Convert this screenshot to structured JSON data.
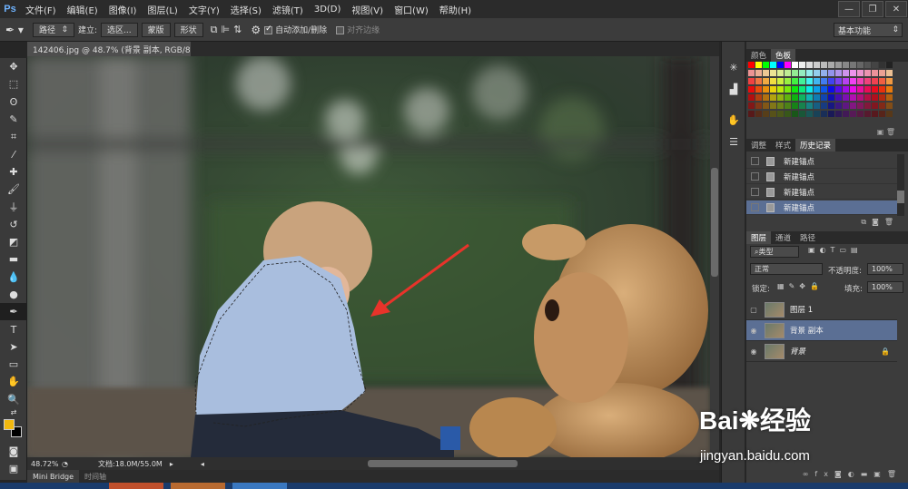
{
  "app": {
    "logo": "Ps"
  },
  "menu": [
    "文件(F)",
    "编辑(E)",
    "图像(I)",
    "图层(L)",
    "文字(Y)",
    "选择(S)",
    "滤镜(T)",
    "3D(D)",
    "视图(V)",
    "窗口(W)",
    "帮助(H)"
  ],
  "window_controls": [
    "—",
    "❐",
    "✕"
  ],
  "options": {
    "mode": "路径",
    "make_label": "建立:",
    "selection_btn": "选区...",
    "mask_btn": "蒙版",
    "shape_btn": "形状",
    "auto_add_delete": "自动添加/删除",
    "align_edges": "对齐边缘",
    "workspace": "基本功能"
  },
  "document": {
    "tab": "142406.jpg @ 48.7% (背景 副本, RGB/8#) *",
    "zoom": "48.72%",
    "doc_size": "文档:18.0M/55.0M"
  },
  "bottom_tabs": [
    "Mini Bridge",
    "时间轴"
  ],
  "panels": {
    "swatch_tabs": [
      "颜色",
      "色板"
    ],
    "history_tabs": [
      "调整",
      "样式",
      "历史记录"
    ],
    "history_items": [
      "新建锚点",
      "新建锚点",
      "新建锚点",
      "新建锚点"
    ],
    "layers_tabs": [
      "图层",
      "通道",
      "路径"
    ],
    "filter_kind": "类型",
    "blend_mode": "正常",
    "opacity_label": "不透明度:",
    "opacity_value": "100%",
    "lock_label": "锁定:",
    "fill_label": "填充:",
    "fill_value": "100%",
    "layers": [
      {
        "name": "图层 1",
        "visible": false
      },
      {
        "name": "背景 副本",
        "visible": true
      },
      {
        "name": "背景",
        "visible": true
      }
    ]
  },
  "colors": {
    "foreground": "#f2b80f",
    "background": "#000000",
    "selection": "#5b6f94",
    "annotation_arrow": "#e8332a"
  },
  "watermark": {
    "brand": "Bai",
    "brand2": "经验",
    "url": "jingyan.baidu.com"
  }
}
